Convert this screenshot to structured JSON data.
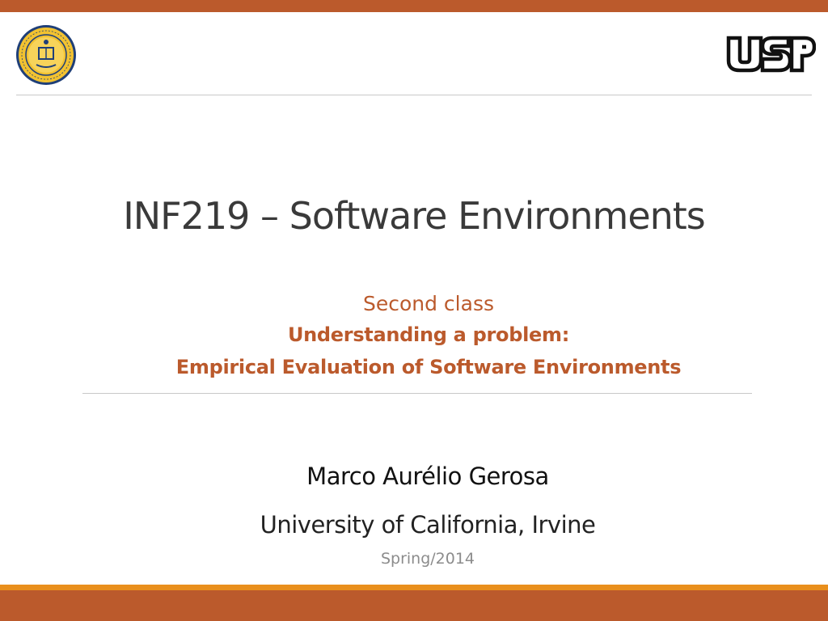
{
  "slide": {
    "title": "INF219 – Software Environments",
    "subtitle": {
      "line1": "Second class",
      "line2": "Understanding a problem:",
      "line3": "Empirical Evaluation of Software Environments"
    },
    "author": "Marco Aurélio Gerosa",
    "affiliation": "University of California, Irvine",
    "term": "Spring/2014"
  },
  "logos": {
    "left": "uc-irvine-seal-icon",
    "right": "usp-logo-icon"
  },
  "colors": {
    "accent": "#bb5a2c",
    "accent_light": "#e98f1c",
    "title_text": "#3a3a3a",
    "muted_text": "#8c8c8c"
  }
}
